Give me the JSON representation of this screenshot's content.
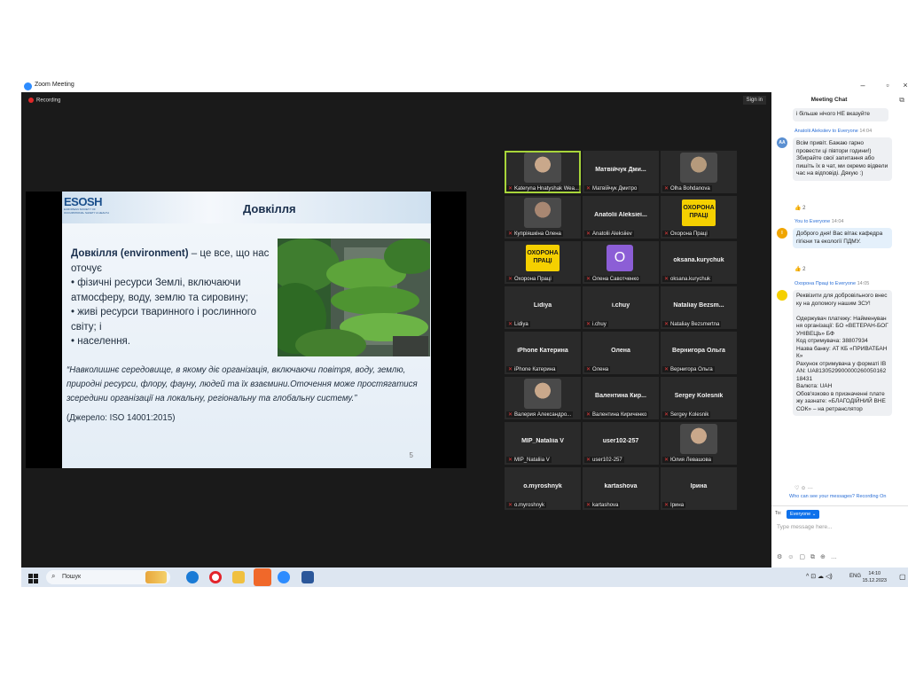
{
  "window": {
    "title": "Zoom Meeting"
  },
  "meeting": {
    "recording": "Recording",
    "sign_in": "Sign in"
  },
  "slide": {
    "logo": "ESOSH",
    "logo_sub": "EUROPEAN SOCIETY OF OCCUPATIONAL SAFETY & HEALTH",
    "title": "Довкілля",
    "body_term": "Довкілля",
    "body_en": " (environment)",
    "body_rest": " – це все, що нас оточує",
    "bullets": [
      "• фізичні ресурси Землі, включаючи атмосферу, воду, землю та сировину;",
      "• живі ресурси тваринного і рослинного світу; і",
      "• населення."
    ],
    "quote": "“Навколишнє середовище, в якому діє організація, включаючи повітря, воду, землю, природні ресурси, флору, фауну, людей та їх взаємини.Оточення може простягатися зсередини організації на локальну, регіональну та глобальну систему.”",
    "source": "(Джерело: ISO 14001:2015)",
    "page": "5"
  },
  "participants": [
    {
      "name": "",
      "label": "Kateryna Hnatyshak Wea...",
      "kind": "video"
    },
    {
      "name": "Матвійчук Дми...",
      "label": "Матвійчук Дмитро",
      "kind": "name"
    },
    {
      "name": "",
      "label": "Olha Bohdanova",
      "kind": "video"
    },
    {
      "name": "",
      "label": "Купріяшкіна Олена",
      "kind": "video"
    },
    {
      "name": "Anatolii Aleksiei...",
      "label": "Anatolii Aleksiiev",
      "kind": "name"
    },
    {
      "name": "",
      "label": "Охорона Праці",
      "kind": "ohorona"
    },
    {
      "name": "",
      "label": "Охорона Праці",
      "kind": "ohorona"
    },
    {
      "name": "O",
      "label": "Олена Савотченко",
      "kind": "avatar"
    },
    {
      "name": "oksana.kurychuk",
      "label": "oksana.kurychuk",
      "kind": "name"
    },
    {
      "name": "Lidiya",
      "label": "Lidiya",
      "kind": "name"
    },
    {
      "name": "i.chuy",
      "label": "i.chuy",
      "kind": "name"
    },
    {
      "name": "Nataliay Bezsm...",
      "label": "Nataliay Bezsmertna",
      "kind": "name"
    },
    {
      "name": "iPhone Катерина",
      "label": "iPhone Катерина",
      "kind": "name"
    },
    {
      "name": "Олена",
      "label": "Олена",
      "kind": "name"
    },
    {
      "name": "Вернигора Ольга",
      "label": "Вернигора Ольга",
      "kind": "name"
    },
    {
      "name": "",
      "label": "Валерия Александро...",
      "kind": "video"
    },
    {
      "name": "Валентина Кир...",
      "label": "Валентина Кириченко",
      "kind": "name"
    },
    {
      "name": "Sergey Kolesnik",
      "label": "Sergey Kolesnik",
      "kind": "name"
    },
    {
      "name": "MIP_Nataliia V",
      "label": "MIP_Nataliia V",
      "kind": "name"
    },
    {
      "name": "user102-257",
      "label": "user102-257",
      "kind": "name"
    },
    {
      "name": "",
      "label": "Юлия Левашова",
      "kind": "video"
    },
    {
      "name": "o.myroshnyk",
      "label": "o.myroshnyk",
      "kind": "name"
    },
    {
      "name": "kartashova",
      "label": "kartashova",
      "kind": "name"
    },
    {
      "name": "Ірина",
      "label": "Ірина",
      "kind": "name"
    }
  ],
  "ohorona_text": "ОХОРОНА ПРАЦІ",
  "chat": {
    "title": "Meeting Chat",
    "prev_tail": "і більше нічого НЕ вказуйте",
    "msg1": {
      "from": "Anatolii Aleksiiev to Everyone",
      "time": "14:04",
      "initials": "AA",
      "text": "Всім привіт. Бажаю гарно провести ці півтори години!) Збирайте свої запитання або пишіть їх в чат, ми окремо відвели час на відповіді. Дякую :)",
      "likes": "👍 2"
    },
    "msg2": {
      "from": "You to Everyone",
      "time": "14:04",
      "initials": "I",
      "text": "Доброго дня! Вас вітає кафедра гігієни та екології ПДМУ.",
      "likes": "👍 2"
    },
    "msg3": {
      "from": "Охорона Праці to Everyone",
      "time": "14:05",
      "text": "Реквізити для добровільного внеску на допомогу нашим ЗСУ!\n\nОдержувач платежу: Найменування організації: БО «ВЕТЕРАН-БОГУНІВЕЦЬ» БФ\nКод отримувача: 38807934\nНазва банку: АТ КБ «ПРИВАТБАНК»\nРахунок отримувача у форматі IBAN: UA813052990000026005016218431\nВалюта: UAH\nОбов'язково в призначенні платежу зазнате: «БЛАГОДІЙНИЙ ВНЕСОК» – на ретранслятор"
    },
    "notice": "Who can see your messages? Recording On",
    "to_label": "To:",
    "to_value": "Everyone ⌄",
    "placeholder": "Type message here..."
  },
  "taskbar": {
    "search": "Пошук",
    "lang": "ENG",
    "time": "14:10",
    "date": "15.12.2023"
  }
}
